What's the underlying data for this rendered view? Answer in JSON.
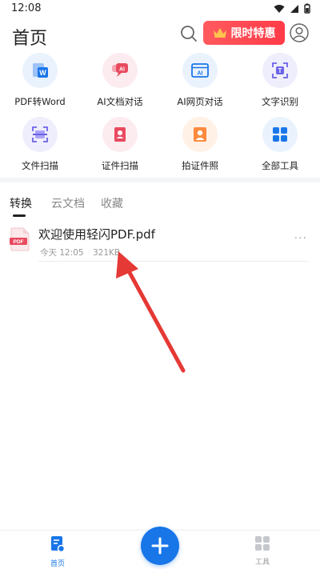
{
  "status": {
    "time": "12:08"
  },
  "header": {
    "title": "首页",
    "promo_label": "限时特惠"
  },
  "tools": [
    {
      "label": "PDF转Word",
      "icon": "pdf-to-word-icon"
    },
    {
      "label": "AI文档对话",
      "icon": "ai-chat-icon"
    },
    {
      "label": "AI网页对话",
      "icon": "ai-web-icon"
    },
    {
      "label": "文字识别",
      "icon": "text-recognition-icon"
    },
    {
      "label": "文件扫描",
      "icon": "scan-icon"
    },
    {
      "label": "证件扫描",
      "icon": "id-scan-icon"
    },
    {
      "label": "拍证件照",
      "icon": "id-photo-icon"
    },
    {
      "label": "全部工具",
      "icon": "all-tools-icon"
    }
  ],
  "tabs": [
    {
      "label": "转换",
      "active": true
    },
    {
      "label": "云文档",
      "active": false
    },
    {
      "label": "收藏",
      "active": false
    }
  ],
  "files": [
    {
      "name": "欢迎使用轻闪PDF.pdf",
      "date": "今天 12:05",
      "size": "321KB",
      "icon_text": "PDF"
    }
  ],
  "bottom_nav": [
    {
      "label": "首页",
      "active": true
    },
    {
      "label": "工具",
      "active": false
    }
  ],
  "colors": {
    "accent": "#1976e8",
    "promo": "#ff3b47",
    "arrow": "#e53935"
  }
}
